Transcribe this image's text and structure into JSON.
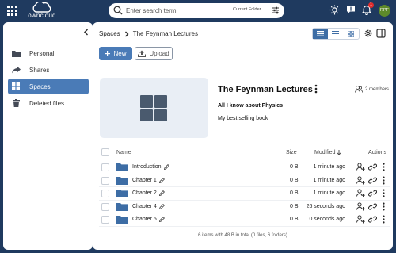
{
  "topbar": {
    "logo_text": "owncloud",
    "search_placeholder": "Enter search term",
    "search_scope": "Current Folder",
    "notification_count": "1",
    "avatar_initials": "RPF"
  },
  "sidebar": {
    "items": [
      {
        "label": "Personal",
        "icon": "folder-icon",
        "active": false
      },
      {
        "label": "Shares",
        "icon": "share-icon",
        "active": false
      },
      {
        "label": "Spaces",
        "icon": "grid-icon",
        "active": true
      },
      {
        "label": "Deleted files",
        "icon": "trash-icon",
        "active": false
      }
    ]
  },
  "breadcrumb": {
    "root": "Spaces",
    "separator": ">",
    "current": "The Feynman Lectures"
  },
  "actions": {
    "new_label": "New",
    "upload_label": "Upload"
  },
  "space": {
    "title": "The Feynman Lectures",
    "members": "2 members",
    "subtitle": "All I know about Physics",
    "description": "My best selling book"
  },
  "table": {
    "headers": {
      "name": "Name",
      "size": "Size",
      "modified": "Modified",
      "actions": "Actions"
    },
    "rows": [
      {
        "name": "Introduction",
        "size": "0 B",
        "modified": "1 minute ago"
      },
      {
        "name": "Chapter 1",
        "size": "0 B",
        "modified": "1 minute ago"
      },
      {
        "name": "Chapter 2",
        "size": "0 B",
        "modified": "1 minute ago"
      },
      {
        "name": "Chapter 4",
        "size": "0 B",
        "modified": "26 seconds ago"
      },
      {
        "name": "Chapter 5",
        "size": "0 B",
        "modified": "0 seconds ago"
      }
    ],
    "footer": "6 items with 48 B in total (0 files, 6 folders)"
  },
  "colors": {
    "brand": "#1f3a5f",
    "accent": "#4a7bb7",
    "folder": "#3d6da5"
  }
}
